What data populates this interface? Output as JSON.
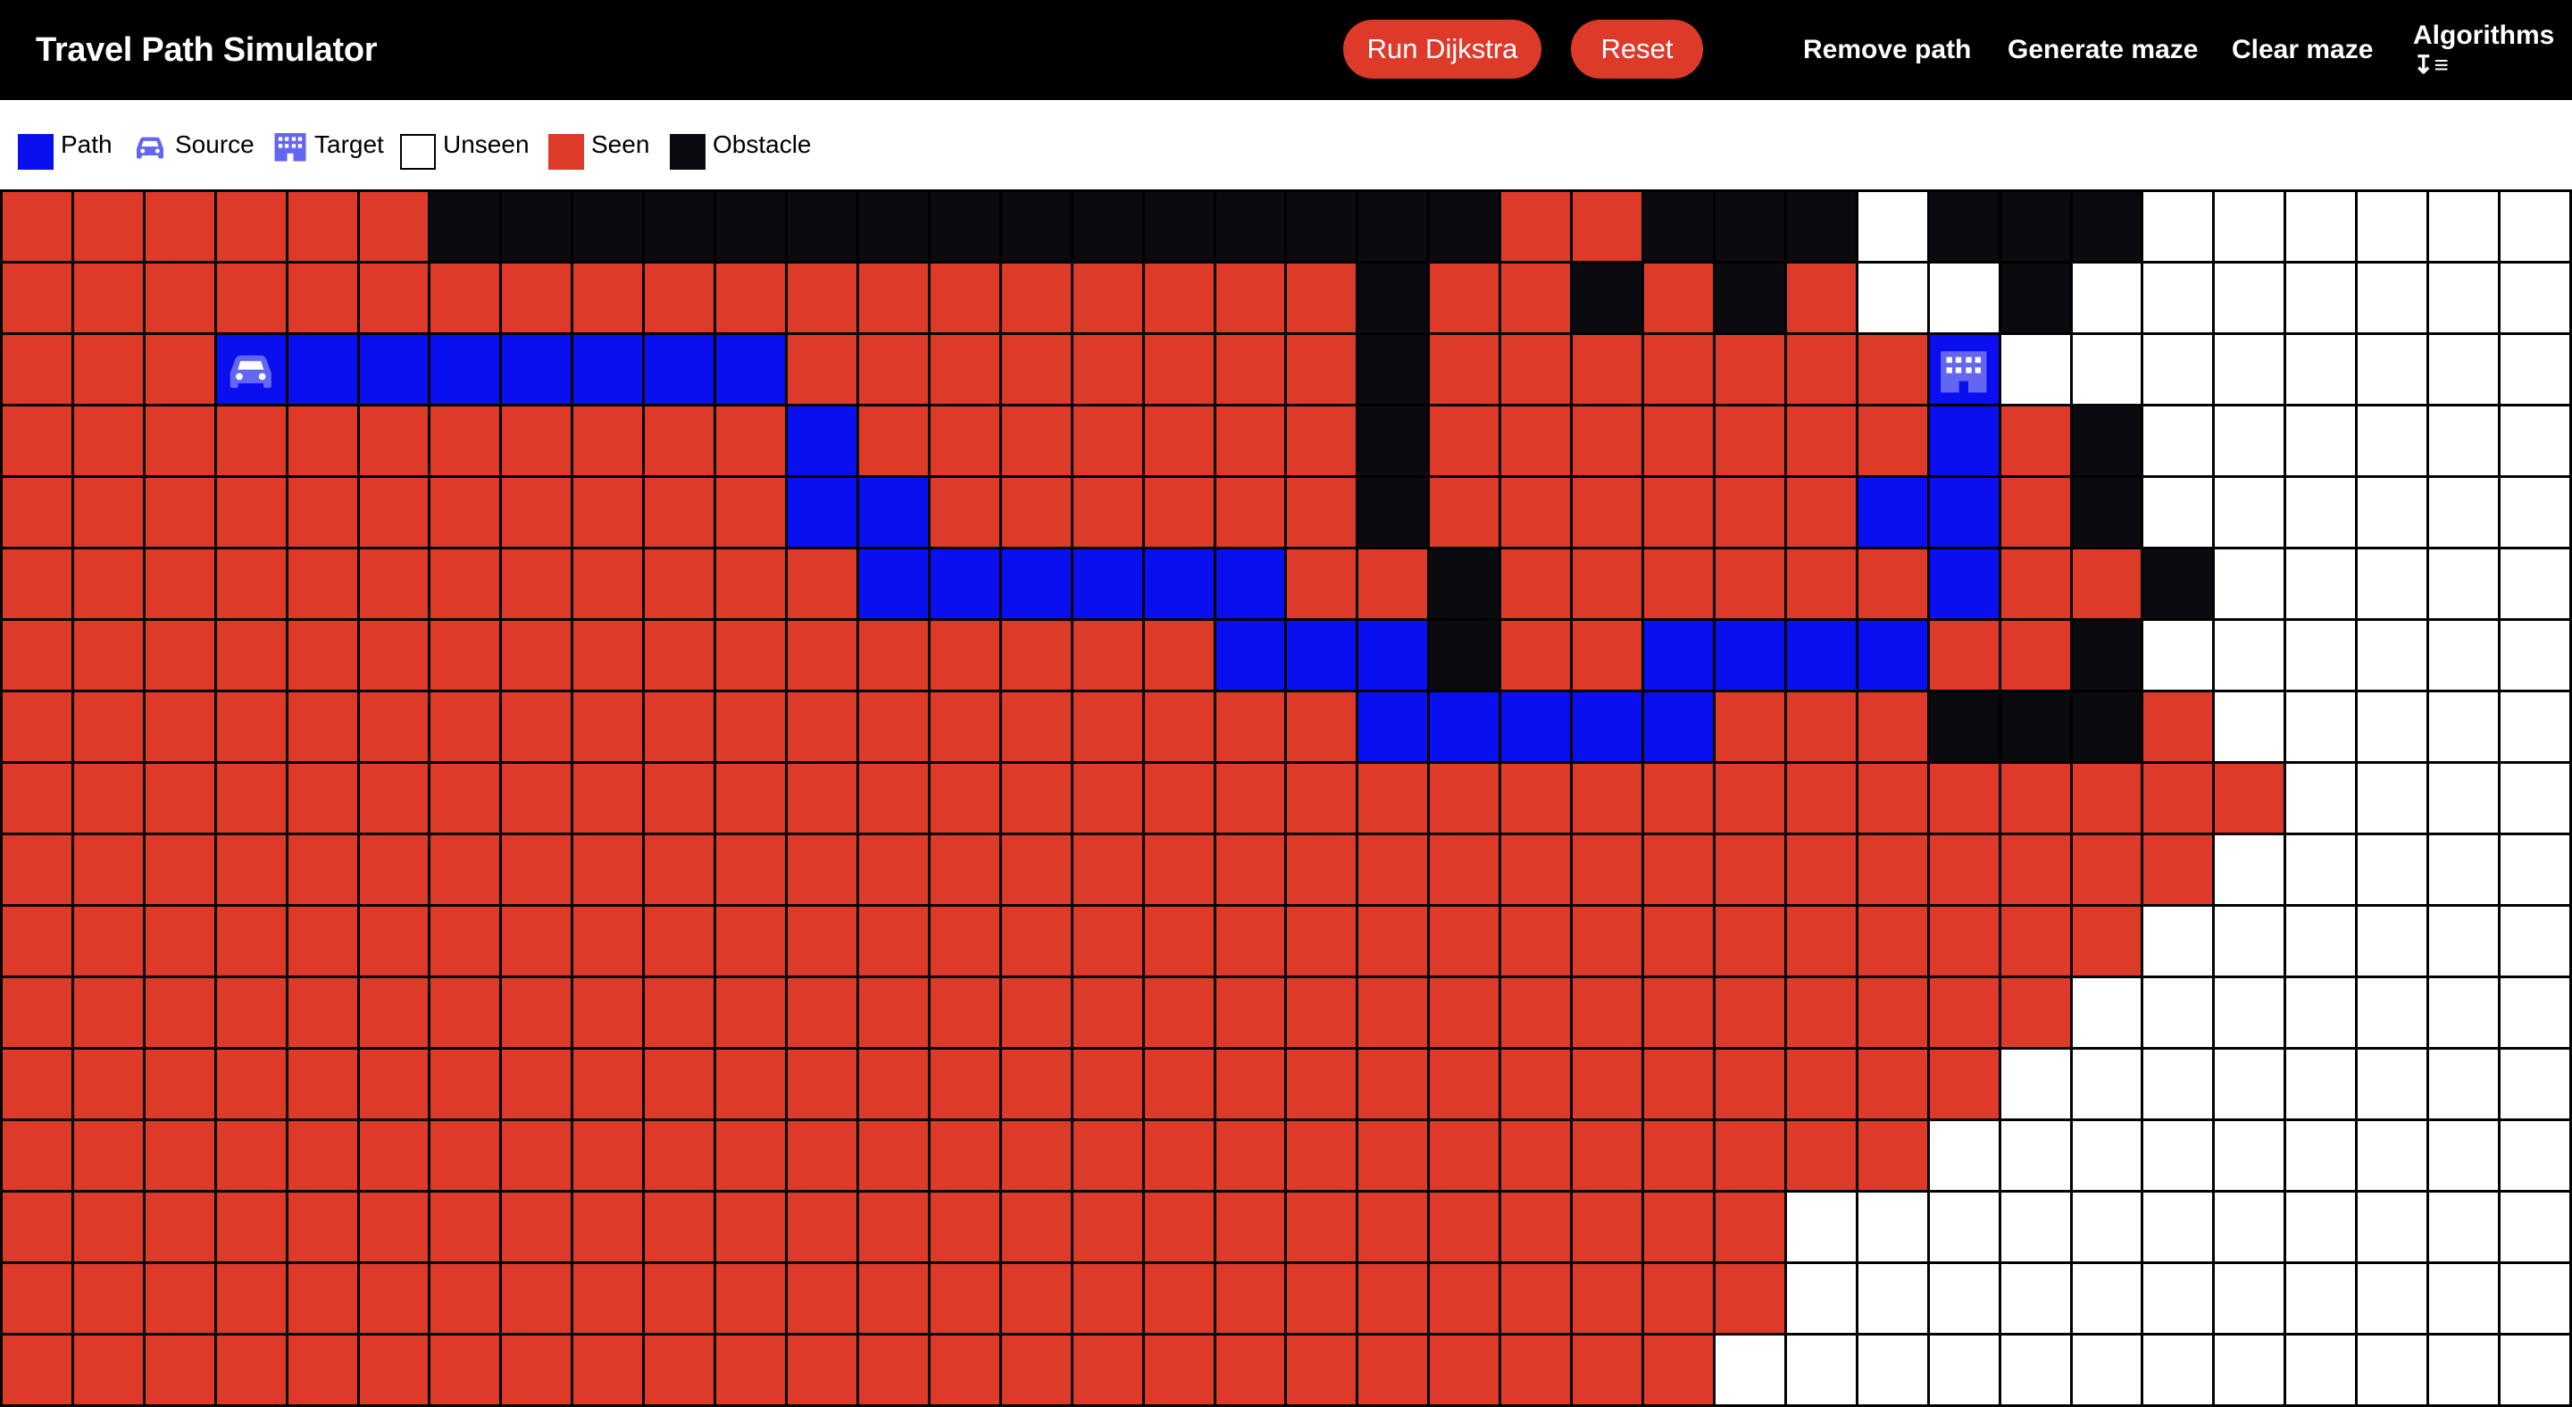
{
  "app": {
    "title": "Travel Path Simulator"
  },
  "toolbar": {
    "run_label": "Run Dijkstra",
    "reset_label": "Reset",
    "remove_path_label": "Remove path",
    "generate_maze_label": "Generate maze",
    "clear_maze_label": "Clear maze",
    "algorithms_label": "Algorithms",
    "algorithms_icon": "sort-descending-icon"
  },
  "legend": {
    "path": {
      "label": "Path",
      "color": "#0a0ff0"
    },
    "source": {
      "label": "Source",
      "icon": "car-icon",
      "color": "#6366f1"
    },
    "target": {
      "label": "Target",
      "icon": "building-icon",
      "color": "#6366f1"
    },
    "unseen": {
      "label": "Unseen",
      "color": "#ffffff"
    },
    "seen": {
      "label": "Seen",
      "color": "#de3a2a"
    },
    "obstacle": {
      "label": "Obstacle",
      "color": "#0b0b0f"
    }
  },
  "grid": {
    "key": {
      "S": "seen",
      "O": "obstacle",
      "W": "unseen",
      "P": "path",
      "A": "source",
      "T": "target"
    },
    "rows": [
      "SSSSSSOOOOOOOOOOOOOOOSSOOOWOOOWWWWWW",
      "SSSSSSSSSSSSSSSSSSSOSSOSOSWWOWWWWWWW",
      "SSSAPPPPPPPSSSSSSSSOSSSSSSSTWWWWWWWW",
      "SSSSSSSSSSSPSSSSSSSOSSSSSSSPSOWWWWWW",
      "SSSSSSSSSSSPPSSSSSSOSSSSSSPPSOWWWWWW",
      "SSSSSSSSSSSSPPPPPPSSOSSSSSSPSSOWWWWWW",
      "SSSSSSSSSSSSSSSSSPPPOSSPPPPSSOWWWWWW",
      "SSSSSSSSSSSSSSSSSSSPPPPPSSSOOOSWWWWW",
      "SSSSSSSSSSSSSSSSSSSSSSSSSSSSSSSSWWWW",
      "SSSSSSSSSSSSSSSSSSSSSSSSSSSSSSSWWWWW",
      "SSSSSSSSSSSSSSSSSSSSSSSSSSSSSSWWWWWW",
      "SSSSSSSSSSSSSSSSSSSSSSSSSSSSSWWWWWWW",
      "SSSSSSSSSSSSSSSSSSSSSSSSSSSSWWWWWWWW",
      "SSSSSSSSSSSSSSSSSSSSSSSSSSSWWWWWWWWW",
      "SSSSSSSSSSSSSSSSSSSSSSSSSWWWWWWWWWWW",
      "SSSSSSSSSSSSSSSSSSSSSSSSSWWWWWWWWWWW",
      "SSSSSSSSSSSSSSSSSSSSSSSSWWWWWWWWWWWW"
    ]
  }
}
